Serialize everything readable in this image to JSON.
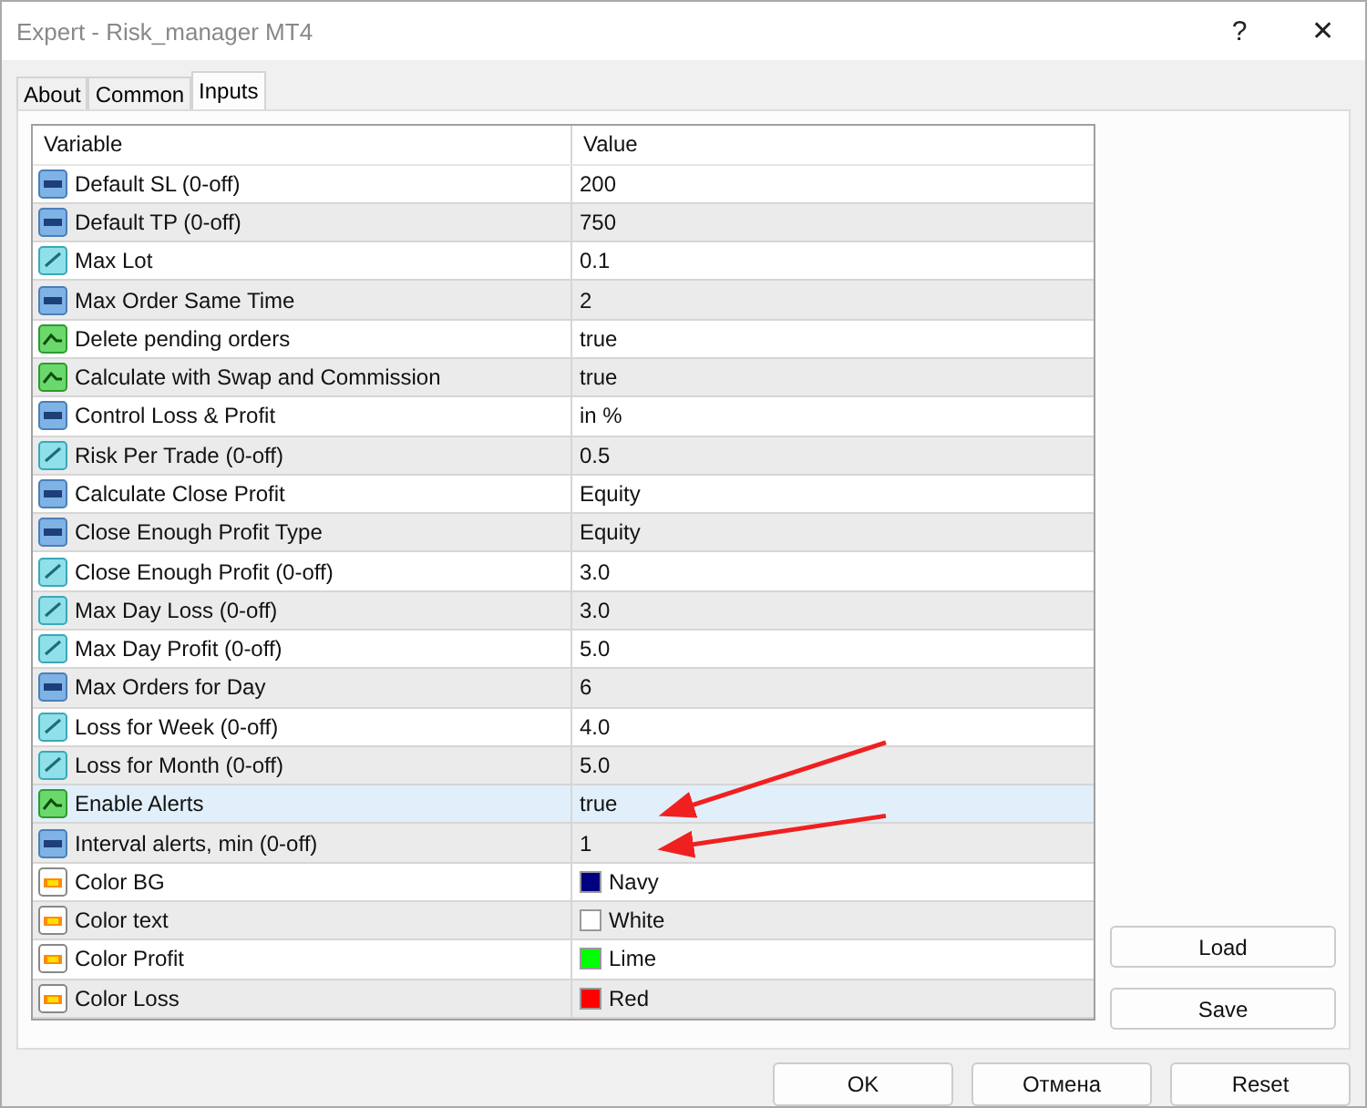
{
  "window": {
    "title": "Expert - Risk_manager MT4",
    "help": "?",
    "close": "✕"
  },
  "tabs": [
    {
      "label": "About",
      "selected": false
    },
    {
      "label": "Common",
      "selected": false
    },
    {
      "label": "Inputs",
      "selected": true
    }
  ],
  "table": {
    "columns": [
      "Variable",
      "Value"
    ],
    "rows": [
      {
        "kind": "int",
        "name": "Default SL (0-off)",
        "value": "200",
        "selected": false,
        "arrow": false
      },
      {
        "kind": "int",
        "name": "Default TP (0-off)",
        "value": "750",
        "selected": false,
        "arrow": false
      },
      {
        "kind": "double",
        "name": "Max Lot",
        "value": "0.1",
        "selected": false,
        "arrow": false
      },
      {
        "kind": "int",
        "name": "Max Order Same Time",
        "value": "2",
        "selected": false,
        "arrow": false
      },
      {
        "kind": "bool",
        "name": "Delete pending orders",
        "value": "true",
        "selected": false,
        "arrow": false
      },
      {
        "kind": "bool",
        "name": "Calculate with Swap and Commission",
        "value": "true",
        "selected": false,
        "arrow": false
      },
      {
        "kind": "int",
        "name": "Control Loss & Profit",
        "value": "in %",
        "selected": false,
        "arrow": false
      },
      {
        "kind": "double",
        "name": "Risk Per Trade (0-off)",
        "value": "0.5",
        "selected": false,
        "arrow": false
      },
      {
        "kind": "int",
        "name": "Calculate Close Profit",
        "value": "Equity",
        "selected": false,
        "arrow": false
      },
      {
        "kind": "int",
        "name": "Close Enough Profit Type",
        "value": "Equity",
        "selected": false,
        "arrow": false
      },
      {
        "kind": "double",
        "name": "Close Enough Profit (0-off)",
        "value": "3.0",
        "selected": false,
        "arrow": false
      },
      {
        "kind": "double",
        "name": "Max Day Loss (0-off)",
        "value": "3.0",
        "selected": false,
        "arrow": false
      },
      {
        "kind": "double",
        "name": "Max Day Profit (0-off)",
        "value": "5.0",
        "selected": false,
        "arrow": false
      },
      {
        "kind": "int",
        "name": "Max Orders for Day",
        "value": "6",
        "selected": false,
        "arrow": false
      },
      {
        "kind": "double",
        "name": "Loss for Week (0-off)",
        "value": "4.0",
        "selected": false,
        "arrow": false
      },
      {
        "kind": "double",
        "name": "Loss for Month (0-off)",
        "value": "5.0",
        "selected": false,
        "arrow": false
      },
      {
        "kind": "bool",
        "name": "Enable Alerts",
        "value": "true",
        "selected": true,
        "arrow": true
      },
      {
        "kind": "int",
        "name": "Interval alerts, min (0-off)",
        "value": "1",
        "selected": false,
        "arrow": true
      },
      {
        "kind": "color",
        "name": "Color BG",
        "value": "Navy",
        "color": "#000080",
        "selected": false,
        "arrow": false
      },
      {
        "kind": "color",
        "name": "Color text",
        "value": "White",
        "color": "#ffffff",
        "selected": false,
        "arrow": false
      },
      {
        "kind": "color",
        "name": "Color Profit",
        "value": "Lime",
        "color": "#00ff00",
        "selected": false,
        "arrow": false
      },
      {
        "kind": "color",
        "name": "Color Loss",
        "value": "Red",
        "color": "#ff0000",
        "selected": false,
        "arrow": false
      }
    ]
  },
  "side_buttons": [
    "Load",
    "Save"
  ],
  "buttons": [
    "OK",
    "Отмена",
    "Reset"
  ]
}
